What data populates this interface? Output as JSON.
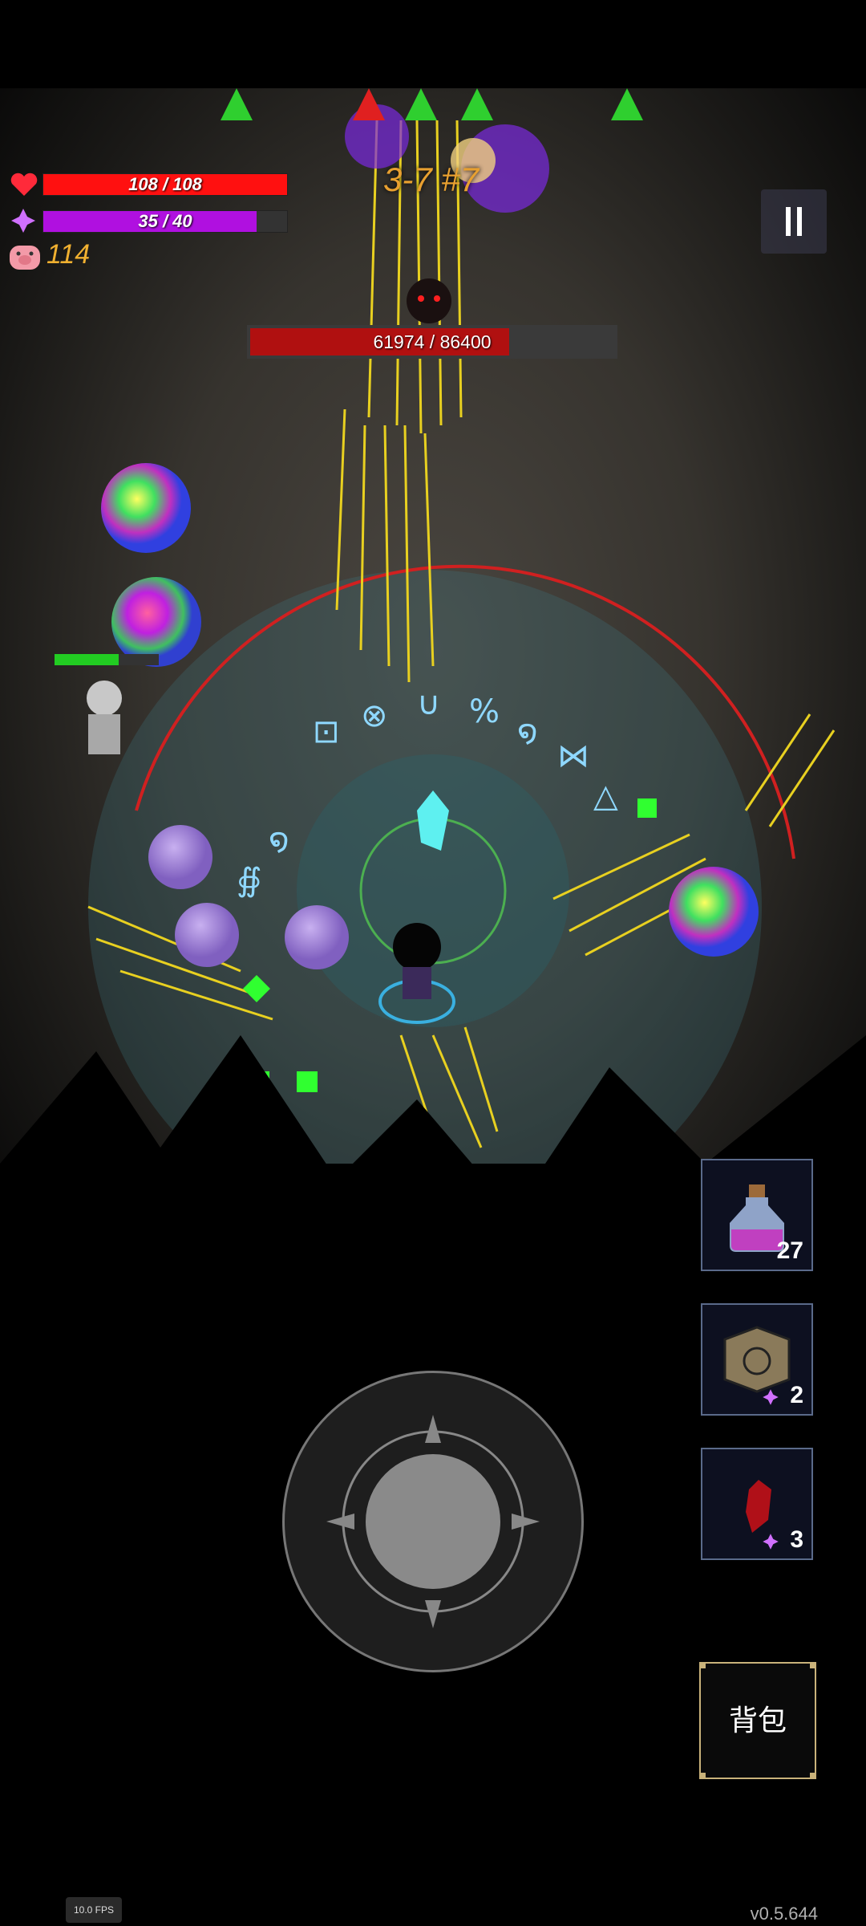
{
  "hud": {
    "health": {
      "current": 108,
      "max": 108,
      "label": "108 / 108",
      "color": "#ff1010"
    },
    "mana": {
      "current": 35,
      "max": 40,
      "label": "35 / 40",
      "color": "#b010e0"
    },
    "coins": "114",
    "stage": "3-7 #7"
  },
  "boss": {
    "hp": 61974,
    "hp_max": 86400,
    "label": "61974 / 86400"
  },
  "items": [
    {
      "name": "mana-potion",
      "count": "27"
    },
    {
      "name": "rune-box",
      "count": "2"
    },
    {
      "name": "red-crystal",
      "count": "3"
    }
  ],
  "bag_label": "背包",
  "fps_label": "10.0 FPS",
  "version": "v0.5.644",
  "colors": {
    "accent": "#c9b27a",
    "gold": "#e8a030",
    "boss_hp": "#b01010"
  },
  "icons": [
    "heart-icon",
    "mana-gem-icon",
    "pig-coin-icon",
    "pause-icon",
    "joystick"
  ]
}
